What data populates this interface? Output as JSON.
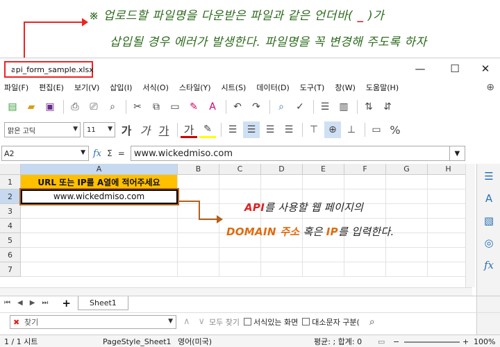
{
  "annotation": {
    "line1_prefix": "※ 업로드할 파일명을 다운받은 파일과 같은 언더바(",
    "line1_highlight": " _ ",
    "line1_suffix": ")가",
    "line2": "삽입될 경우 에러가 발생한다. 파일명을 꼭 변경해 주도록 하자",
    "center_line1_highlight": "API",
    "center_line1_rest": "를 사용할 웹 페이지의",
    "center_line2_h1": "DOMAIN 주소",
    "center_line2_mid": " 혹은 ",
    "center_line2_h2": "IP",
    "center_line2_rest": "를 입력한다."
  },
  "window": {
    "title": "api_form_sample.xlsx",
    "minimize": "—",
    "maximize": "☐",
    "close": "✕"
  },
  "menu": [
    "파일(F)",
    "편집(E)",
    "보기(V)",
    "삽입(I)",
    "서식(O)",
    "스타일(Y)",
    "시트(S)",
    "데이터(D)",
    "도구(T)",
    "창(W)",
    "도움말(H)"
  ],
  "toolbar2": {
    "font_name": "맑은 고딕",
    "font_size": "11",
    "bold": "가",
    "italic": "가",
    "underline": "가",
    "fontcolor": "가",
    "percent": "%"
  },
  "formula": {
    "cell_ref": "A2",
    "fx": "fx",
    "sigma": "Σ",
    "equals": "=",
    "content": "www.wickedmiso.com"
  },
  "columns": [
    "A",
    "B",
    "C",
    "D",
    "E",
    "F",
    "G",
    "H"
  ],
  "rows": [
    "1",
    "2",
    "3",
    "4",
    "5",
    "6",
    "7"
  ],
  "cells": {
    "a1": "URL 또는 IP를 A열에 적어주세요",
    "a2": "www.wickedmiso.com"
  },
  "sheets": {
    "add": "+",
    "tab1": "Sheet1"
  },
  "findbar": {
    "placeholder": "찾기",
    "find_all": "모두 찾기",
    "formatted_display": "서식있는 화면",
    "match_case": "대소문자 구분("
  },
  "status": {
    "sheet_pos": "1 / 1 시트",
    "page_style": "PageStyle_Sheet1",
    "language": "영어(미국)",
    "sum": "평균: ; 합계: 0",
    "zoom": "100%"
  }
}
